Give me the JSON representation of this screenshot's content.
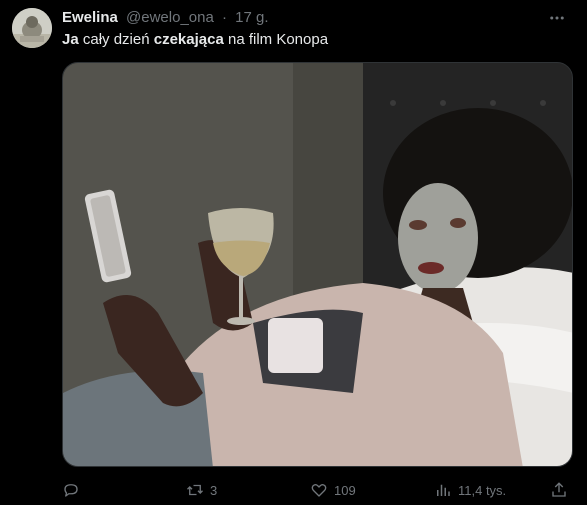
{
  "tweet": {
    "author_name": "Ewelina",
    "handle": "@ewelo_ona",
    "separator": "·",
    "time": "17 g.",
    "text_parts": [
      {
        "text": "Ja",
        "bold": true
      },
      {
        "text": " cały dzień ",
        "bold": false
      },
      {
        "text": "czekająca",
        "bold": true
      },
      {
        "text": " na film Konopa",
        "bold": false
      }
    ]
  },
  "actions": {
    "reply_count": "",
    "retweet_count": "3",
    "like_count": "109",
    "views_count": "11,4 tys."
  },
  "icons": [
    "more-icon",
    "reply-icon",
    "retweet-icon",
    "like-icon",
    "views-icon",
    "share-icon"
  ],
  "colors": {
    "background": "#000000",
    "text_primary": "#e7e9ea",
    "text_secondary": "#71767b",
    "border": "#2f3336"
  }
}
